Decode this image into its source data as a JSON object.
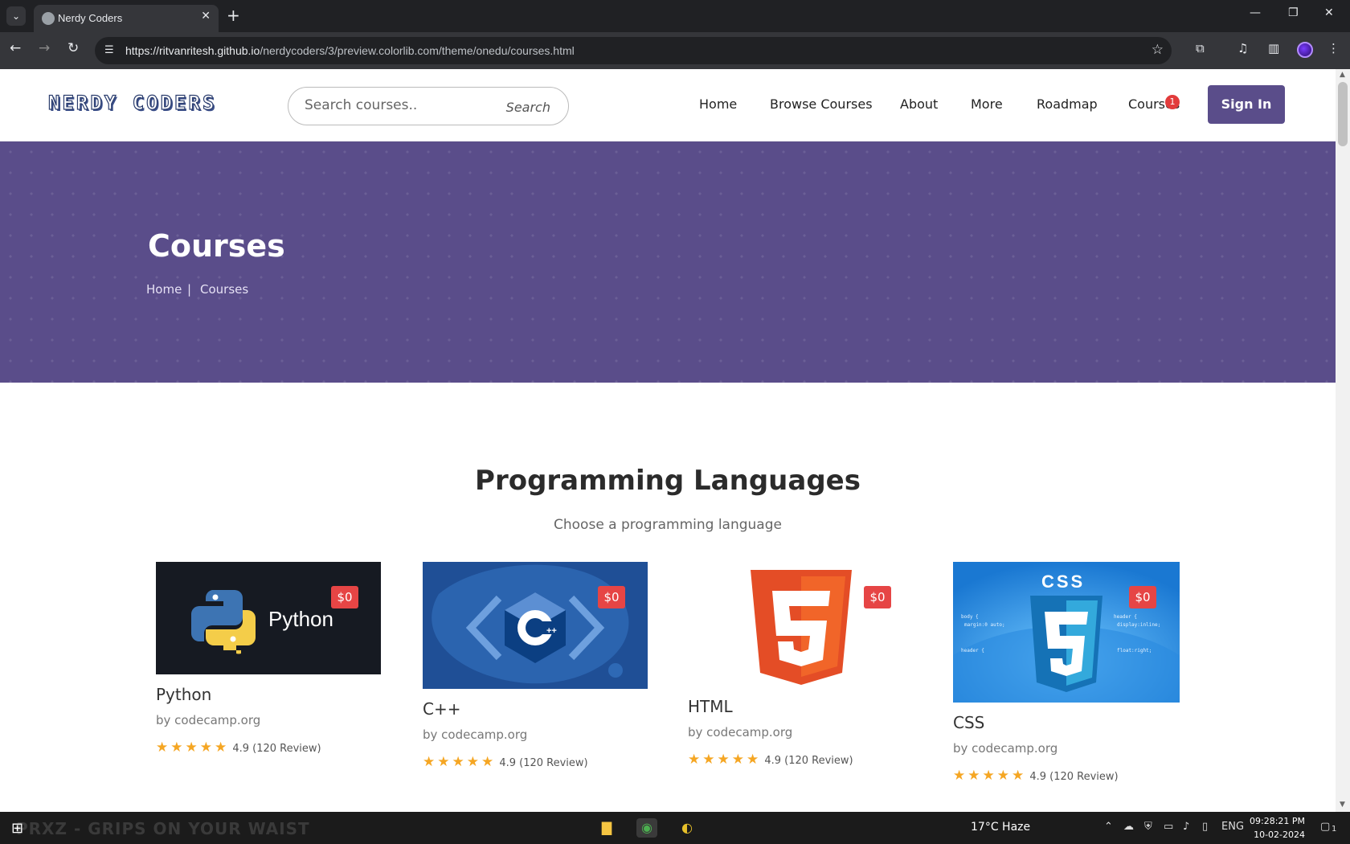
{
  "browser": {
    "tab_title": "Nerdy Coders",
    "url_host": "https://ritvanritesh.github.io",
    "url_path": "/nerdycoders/3/preview.colorlib.com/theme/onedu/courses.html"
  },
  "header": {
    "logo": "NERDY CODERS",
    "search_placeholder": "Search courses..",
    "search_button": "Search",
    "nav": [
      "Home",
      "Browse Courses",
      "About",
      "More",
      "Roadmap",
      "Courses"
    ],
    "cart_badge": "1",
    "signin": "Sign In"
  },
  "banner": {
    "title": "Courses",
    "breadcrumb": [
      "Home",
      "Courses"
    ],
    "separator": "|"
  },
  "section": {
    "title": "Programming Languages",
    "subtitle": "Choose a programming language"
  },
  "courses": [
    {
      "name": "Python",
      "by": "by codecamp.org",
      "price": "$0",
      "rating": "4.9 (120 Review)",
      "stars": 5,
      "image_text": "Python"
    },
    {
      "name": "C++",
      "by": "by codecamp.org",
      "price": "$0",
      "rating": "4.9 (120 Review)",
      "stars": 5,
      "image_text": "C++"
    },
    {
      "name": "HTML",
      "by": "by codecamp.org",
      "price": "$0",
      "rating": "4.9 (120 Review)",
      "stars": 5,
      "image_text": "5"
    },
    {
      "name": "CSS",
      "by": "by codecamp.org",
      "price": "$0",
      "rating": "4.9 (120 Review)",
      "stars": 5,
      "image_text": "CSS"
    }
  ],
  "taskbar": {
    "background_text": "PRXZ - GRIPS ON YOUR WAIST",
    "weather": "17°C  Haze",
    "lang": "ENG",
    "time": "09:28:21 PM",
    "date": "10-02-2024",
    "notifications": "1"
  },
  "colors": {
    "brand_purple": "#5a4d8a",
    "price_red": "#e64545",
    "star_orange": "#f5a623"
  }
}
